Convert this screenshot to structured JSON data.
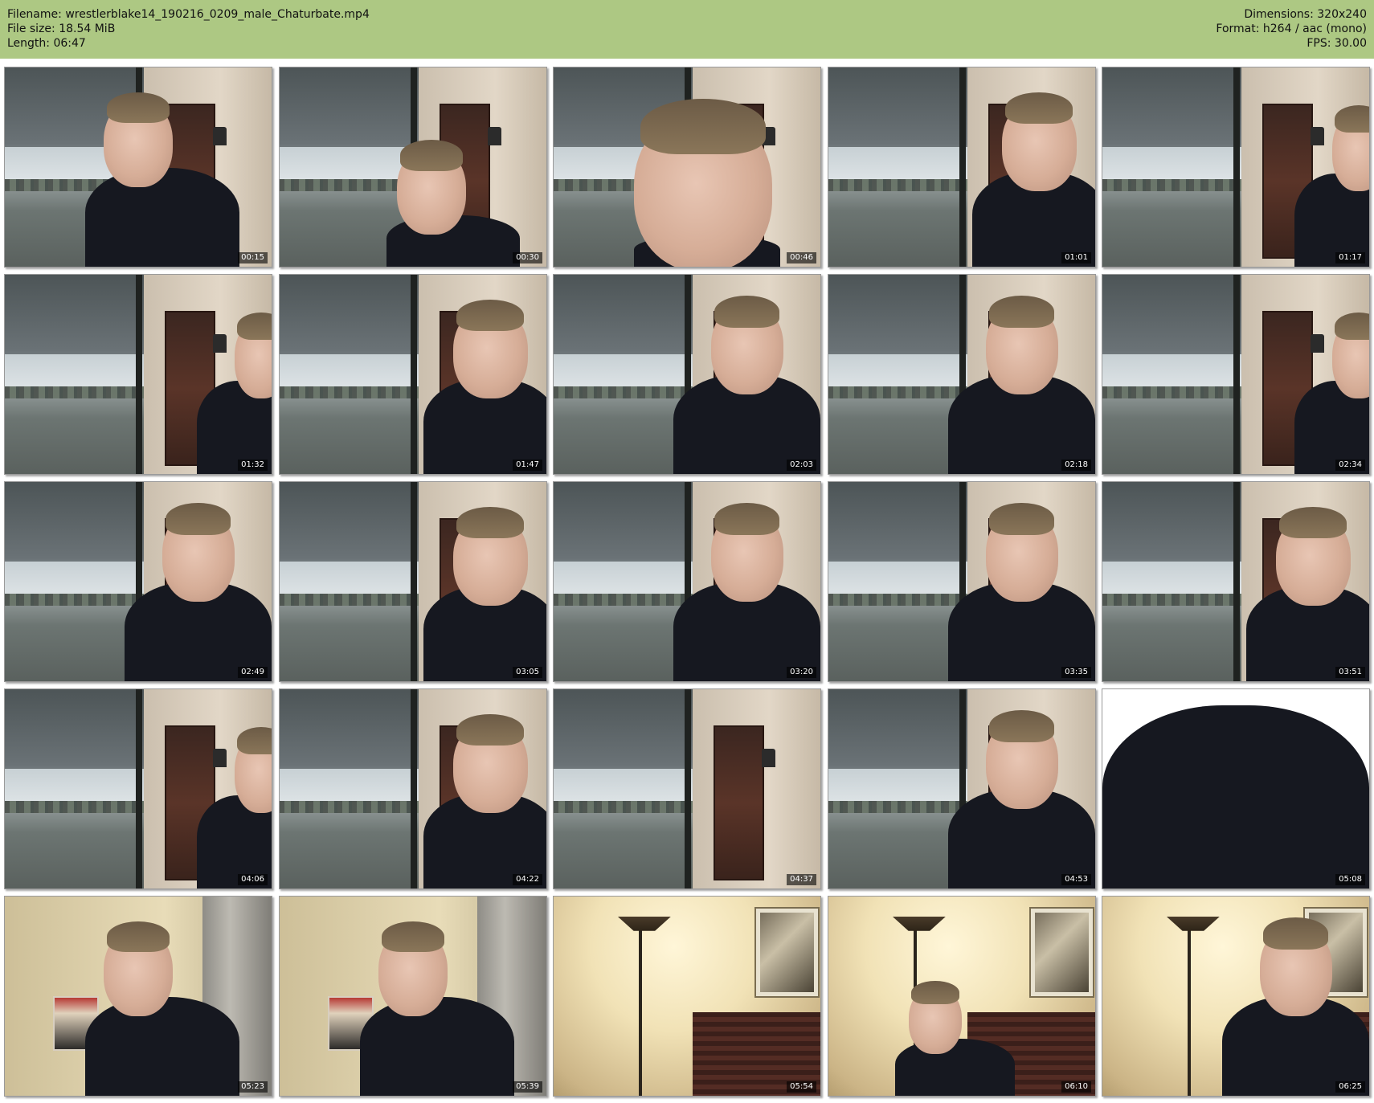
{
  "header": {
    "filename_label": "Filename:",
    "filename": "wrestlerblake14_190216_0209_male_Chaturbate.mp4",
    "filesize_label": "File size:",
    "filesize": "18.54 MiB",
    "length_label": "Length:",
    "length": "06:47",
    "dimensions_label": "Dimensions:",
    "dimensions": "320x240",
    "format_label": "Format:",
    "format": "h264 / aac (mono)",
    "fps_label": "FPS:",
    "fps": "30.00"
  },
  "colors": {
    "header_bg": "#adc883",
    "page_bg": "#ffffff"
  },
  "thumbnails": [
    {
      "timestamp": "00:15",
      "scene": "porch",
      "pose": "center"
    },
    {
      "timestamp": "00:30",
      "scene": "porch",
      "pose": "low-right"
    },
    {
      "timestamp": "00:46",
      "scene": "porch",
      "pose": "close-left"
    },
    {
      "timestamp": "01:01",
      "scene": "porch",
      "pose": "right"
    },
    {
      "timestamp": "01:17",
      "scene": "porch",
      "pose": "edge-right"
    },
    {
      "timestamp": "01:32",
      "scene": "porch",
      "pose": "edge-right"
    },
    {
      "timestamp": "01:47",
      "scene": "porch",
      "pose": "right"
    },
    {
      "timestamp": "02:03",
      "scene": "porch",
      "pose": "center-right"
    },
    {
      "timestamp": "02:18",
      "scene": "porch",
      "pose": "center-right"
    },
    {
      "timestamp": "02:34",
      "scene": "porch",
      "pose": "edge-right"
    },
    {
      "timestamp": "02:49",
      "scene": "porch",
      "pose": "center-right"
    },
    {
      "timestamp": "03:05",
      "scene": "porch",
      "pose": "right"
    },
    {
      "timestamp": "03:20",
      "scene": "porch",
      "pose": "center-right"
    },
    {
      "timestamp": "03:35",
      "scene": "porch",
      "pose": "center-right"
    },
    {
      "timestamp": "03:51",
      "scene": "porch",
      "pose": "right"
    },
    {
      "timestamp": "04:06",
      "scene": "porch",
      "pose": "edge-right"
    },
    {
      "timestamp": "04:22",
      "scene": "porch",
      "pose": "right"
    },
    {
      "timestamp": "04:37",
      "scene": "porch",
      "pose": "none"
    },
    {
      "timestamp": "04:53",
      "scene": "porch",
      "pose": "center-right"
    },
    {
      "timestamp": "05:08",
      "scene": "closeup",
      "pose": "torso"
    },
    {
      "timestamp": "05:23",
      "scene": "bedroom-curtain",
      "pose": "center"
    },
    {
      "timestamp": "05:39",
      "scene": "bedroom-curtain",
      "pose": "center"
    },
    {
      "timestamp": "05:54",
      "scene": "bedroom",
      "pose": "none"
    },
    {
      "timestamp": "06:10",
      "scene": "bedroom",
      "pose": "low-left"
    },
    {
      "timestamp": "06:25",
      "scene": "bedroom",
      "pose": "center-right"
    }
  ]
}
